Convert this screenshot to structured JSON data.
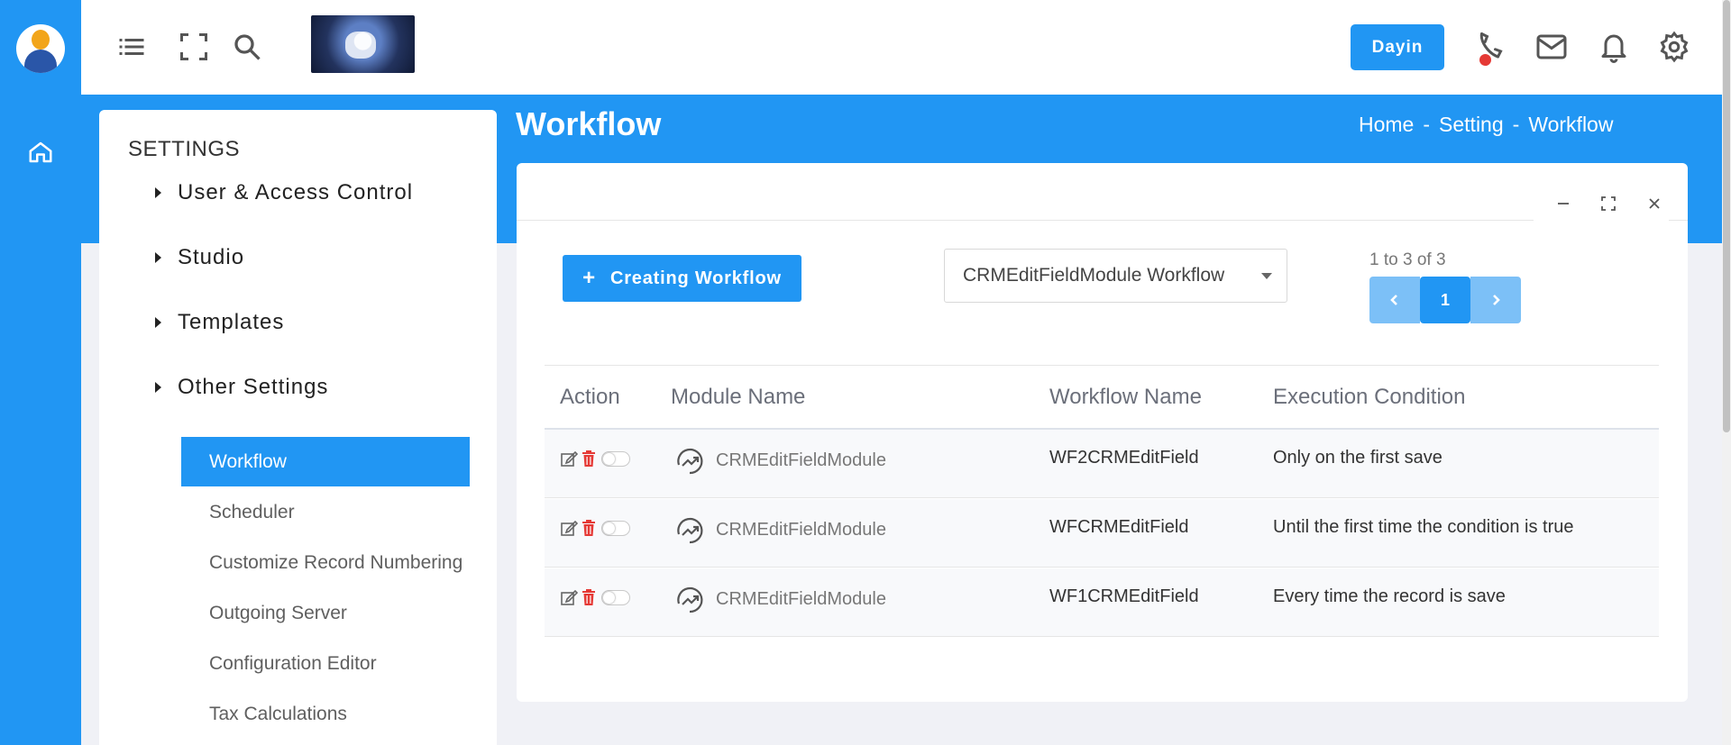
{
  "topbar": {
    "dayin_label": "Dayin",
    "icons": [
      "menu-list-icon",
      "fullscreen-icon",
      "search-icon",
      "phone-icon",
      "mail-icon",
      "bell-icon",
      "gear-icon"
    ]
  },
  "header": {
    "title": "Workflow",
    "breadcrumb": [
      "Home",
      "Setting",
      "Workflow"
    ],
    "breadcrumb_sep": "-"
  },
  "settings": {
    "heading": "SETTINGS",
    "groups": [
      "User & Access Control",
      "Studio",
      "Templates",
      "Other Settings"
    ],
    "items": [
      {
        "label": "Workflow",
        "active": true
      },
      {
        "label": "Scheduler",
        "active": false
      },
      {
        "label": "Customize Record Numbering",
        "active": false
      },
      {
        "label": "Outgoing Server",
        "active": false
      },
      {
        "label": "Configuration Editor",
        "active": false
      },
      {
        "label": "Tax Calculations",
        "active": false
      }
    ]
  },
  "main": {
    "create_label": "Creating Workflow",
    "select_value": "CRMEditFieldModule Workflow",
    "pagination": {
      "info": "1 to 3 of 3",
      "current": "1"
    },
    "columns": [
      "Action",
      "Module Name",
      "Workflow Name",
      "Execution Condition"
    ],
    "rows": [
      {
        "module": "CRMEditFieldModule",
        "workflow": "WF2CRMEditField",
        "condition": "Only on the first save"
      },
      {
        "module": "CRMEditFieldModule",
        "workflow": "WFCRMEditField",
        "condition": "Until the first time the condition is true"
      },
      {
        "module": "CRMEditFieldModule",
        "workflow": "WF1CRMEditField",
        "condition": "Every time the record is save"
      }
    ]
  },
  "colors": {
    "accent": "#2196f3",
    "delete": "#e53935",
    "light_accent": "#7cc0f7"
  }
}
